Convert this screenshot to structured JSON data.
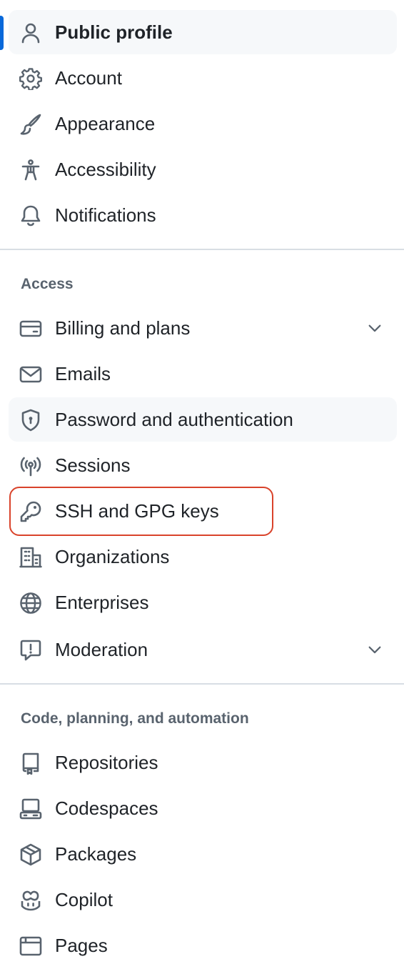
{
  "nav": {
    "items_top": [
      {
        "label": "Public profile",
        "icon": "person-icon"
      },
      {
        "label": "Account",
        "icon": "gear-icon"
      },
      {
        "label": "Appearance",
        "icon": "paintbrush-icon"
      },
      {
        "label": "Accessibility",
        "icon": "accessibility-icon"
      },
      {
        "label": "Notifications",
        "icon": "bell-icon"
      }
    ],
    "access_heading": "Access",
    "items_access": [
      {
        "label": "Billing and plans",
        "icon": "credit-card-icon"
      },
      {
        "label": "Emails",
        "icon": "mail-icon"
      },
      {
        "label": "Password and authentication",
        "icon": "shield-lock-icon"
      },
      {
        "label": "Sessions",
        "icon": "broadcast-icon"
      },
      {
        "label": "SSH and GPG keys",
        "icon": "key-icon"
      },
      {
        "label": "Organizations",
        "icon": "organization-icon"
      },
      {
        "label": "Enterprises",
        "icon": "globe-icon"
      },
      {
        "label": "Moderation",
        "icon": "report-icon"
      }
    ],
    "code_heading": "Code, planning, and automation",
    "items_code": [
      {
        "label": "Repositories",
        "icon": "repo-icon"
      },
      {
        "label": "Codespaces",
        "icon": "codespaces-icon"
      },
      {
        "label": "Packages",
        "icon": "package-icon"
      },
      {
        "label": "Copilot",
        "icon": "copilot-icon"
      },
      {
        "label": "Pages",
        "icon": "browser-icon"
      }
    ]
  },
  "colors": {
    "active_indicator": "#0969da",
    "highlight_border": "#d9432b",
    "icon": "#59636e",
    "text": "#1f2328"
  }
}
